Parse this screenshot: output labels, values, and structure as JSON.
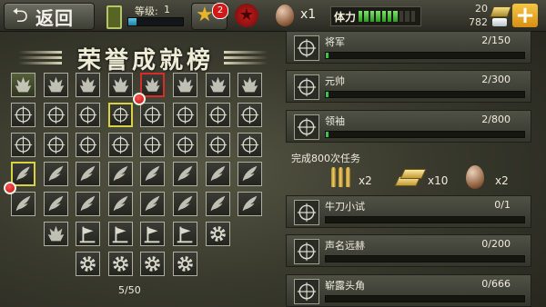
{
  "topbar": {
    "back_label": "返回",
    "level_label": "等级:",
    "level_value": "1",
    "level_progress": 0.15,
    "star_badge": "2",
    "egg_count": "x1",
    "stamina_label": "体力",
    "stamina_segments_filled": 7,
    "stamina_segments_total": 10,
    "resource_top": "20",
    "resource_bottom": "782"
  },
  "page": {
    "title": "荣誉成就榜",
    "pager": "5/50"
  },
  "tasks_top": [
    {
      "name": "将军",
      "progress": "2/150",
      "fraction": 0.013
    },
    {
      "name": "元帅",
      "progress": "2/300",
      "fraction": 0.007
    },
    {
      "name": "领袖",
      "progress": "2/800",
      "fraction": 0.003
    }
  ],
  "reward": {
    "title": "完成800次任务",
    "items": [
      {
        "icon": "bullets-icon",
        "count": "x2"
      },
      {
        "icon": "gold-bars-icon",
        "count": "x10"
      },
      {
        "icon": "egg-icon",
        "count": "x2"
      }
    ]
  },
  "tasks_bottom": [
    {
      "name": "牛刀小试",
      "progress": "0/1",
      "fraction": 0
    },
    {
      "name": "声名远赫",
      "progress": "0/200",
      "fraction": 0
    },
    {
      "name": "崭露头角",
      "progress": "0/666",
      "fraction": 0
    }
  ],
  "grid": {
    "rows": [
      [
        "flame-lit",
        "flame",
        "flame",
        "flame",
        "flame-sel",
        "flame",
        "flame",
        "flame"
      ],
      [
        "target",
        "target",
        "target",
        "target-hi",
        "target",
        "target",
        "target",
        "target"
      ],
      [
        "target",
        "target",
        "target",
        "target",
        "target",
        "target",
        "target",
        "target"
      ],
      [
        "wing-hi",
        "wing",
        "wing",
        "wing",
        "wing",
        "wing",
        "wing",
        "wing"
      ],
      [
        "wing",
        "wing",
        "wing",
        "wing",
        "wing",
        "wing",
        "wing",
        "wing"
      ],
      [
        "empty",
        "flame",
        "flag",
        "flag",
        "flag",
        "flag",
        "gear",
        "empty"
      ],
      [
        "empty",
        "empty",
        "gear",
        "gear",
        "gear",
        "gear",
        "empty",
        "empty"
      ]
    ],
    "dots": [
      [
        0,
        4
      ],
      [
        3,
        0
      ]
    ]
  },
  "colors": {
    "accent_gold": "#e8b52a",
    "progress_green": "#3cc24a",
    "alert_red": "#d01a1a"
  }
}
